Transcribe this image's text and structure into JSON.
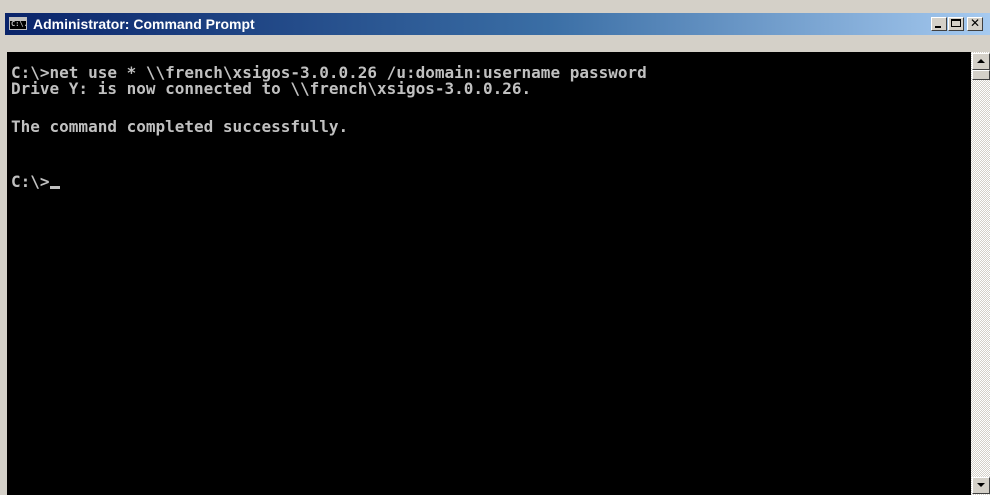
{
  "window": {
    "title": "Administrator: Command Prompt",
    "icon": "console-icon",
    "icon_label": "C:\\."
  },
  "controls": {
    "minimize_icon": "minimize-icon",
    "maximize_icon": "maximize-icon",
    "close_icon": "close-icon",
    "close_glyph": "✕"
  },
  "console": {
    "lines": [
      "C:\\>net use * \\\\french\\xsigos-3.0.0.26 /u:domain:username password",
      "Drive Y: is now connected to \\\\french\\xsigos-3.0.0.26.",
      "The command completed successfully.",
      "C:\\>"
    ],
    "text_color": "#c0c0c0",
    "background_color": "#000000"
  },
  "scrollbar": {
    "up_icon": "scroll-up-arrow-icon",
    "down_icon": "scroll-down-arrow-icon"
  },
  "colors": {
    "titlebar_start": "#0a246a",
    "titlebar_end": "#a6caf0",
    "chrome": "#d4d0c8"
  }
}
